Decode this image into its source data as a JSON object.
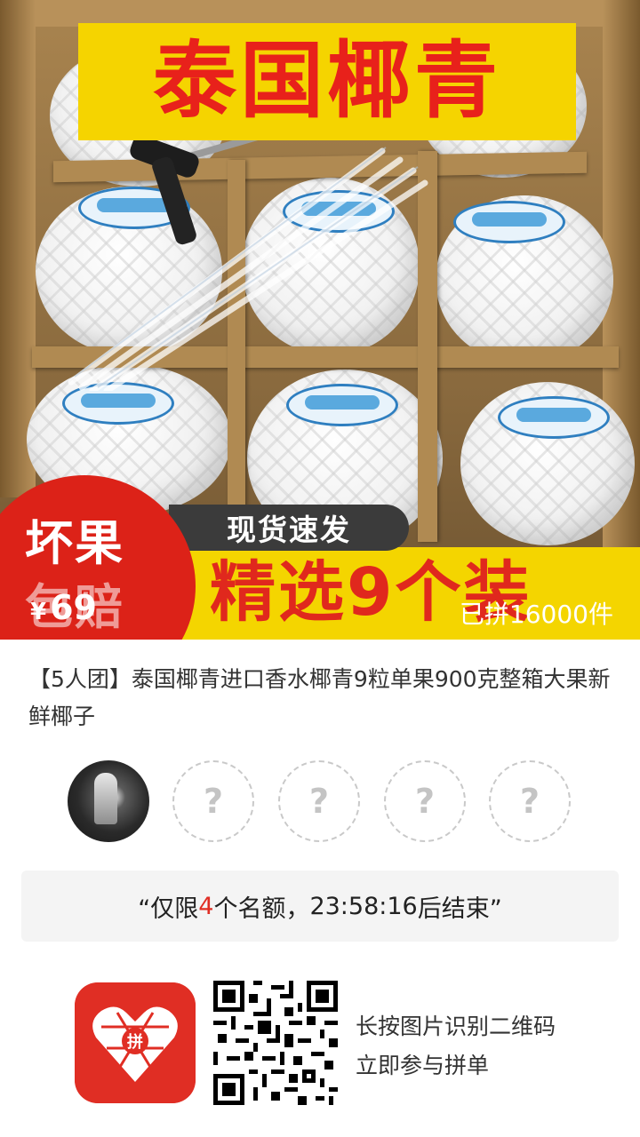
{
  "hero": {
    "title_banner": "泰国椰青",
    "badge_line1": "坏果",
    "badge_line2": "包赔",
    "ship_tag": "现货速发",
    "select_tag": "精选9个装",
    "price_symbol": "¥",
    "price_value": "69",
    "sold_count": "已拼16000件"
  },
  "product": {
    "title": "【5人团】泰国椰青进口香水椰青9粒单果900克整箱大果新鲜椰子"
  },
  "group": {
    "empty_slot_mark": "?",
    "slots_total": 5,
    "slots_filled": 1
  },
  "notice": {
    "prefix": "“仅限",
    "count": "4",
    "middle": "个名额，",
    "timer": "23:58:16",
    "suffix": "后结束”"
  },
  "footer": {
    "line1": "长按图片识别二维码",
    "line2": "立即参与拼单",
    "logo_char": "拼"
  },
  "colors": {
    "accent_red": "#e02e24",
    "banner_yellow": "#f5d400",
    "text_dark": "#333333"
  }
}
